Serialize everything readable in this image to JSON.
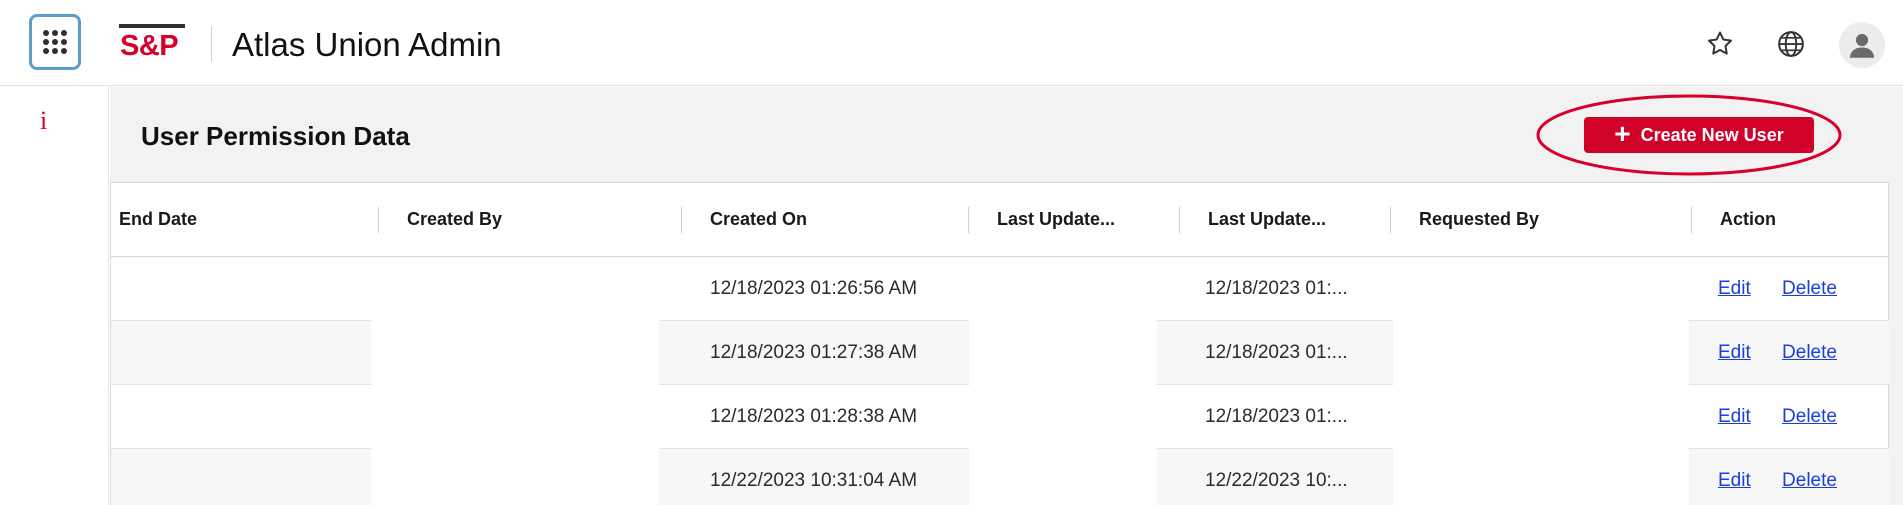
{
  "header": {
    "logo_text": "S&P",
    "app_title": "Atlas Union Admin",
    "icons": [
      "app-grid-icon",
      "star-icon",
      "globe-icon",
      "user-avatar-icon"
    ]
  },
  "rail": {
    "info_label": "i"
  },
  "panel": {
    "title": "User Permission Data",
    "create_button_label": "Create New User",
    "create_button_icon": "plus-icon"
  },
  "table": {
    "columns": [
      "End Date",
      "Created By",
      "Created On",
      "Last Update...",
      "Last Update...",
      "Requested By",
      "Action"
    ],
    "rows": [
      {
        "end_date": "",
        "created_by": "",
        "created_on": "12/18/2023 01:26:56 AM",
        "last_update_1": "",
        "last_update_2": "12/18/2023 01:...",
        "requested_by": "",
        "edit": "Edit",
        "delete": "Delete"
      },
      {
        "end_date": "",
        "created_by": "",
        "created_on": "12/18/2023 01:27:38 AM",
        "last_update_1": "",
        "last_update_2": "12/18/2023 01:...",
        "requested_by": "",
        "edit": "Edit",
        "delete": "Delete"
      },
      {
        "end_date": "",
        "created_by": "",
        "created_on": "12/18/2023 01:28:38 AM",
        "last_update_1": "",
        "last_update_2": "12/18/2023 01:...",
        "requested_by": "",
        "edit": "Edit",
        "delete": "Delete"
      },
      {
        "end_date": "",
        "created_by": "",
        "created_on": "12/22/2023 10:31:04 AM",
        "last_update_1": "",
        "last_update_2": "12/22/2023 10:...",
        "requested_by": "",
        "edit": "Edit",
        "delete": "Delete"
      }
    ]
  },
  "colors": {
    "brand_red": "#d1022a",
    "link_blue": "#1a3fd6",
    "grid_button_border": "#5b9ec9",
    "annotation_ellipse": "#d6002a"
  }
}
